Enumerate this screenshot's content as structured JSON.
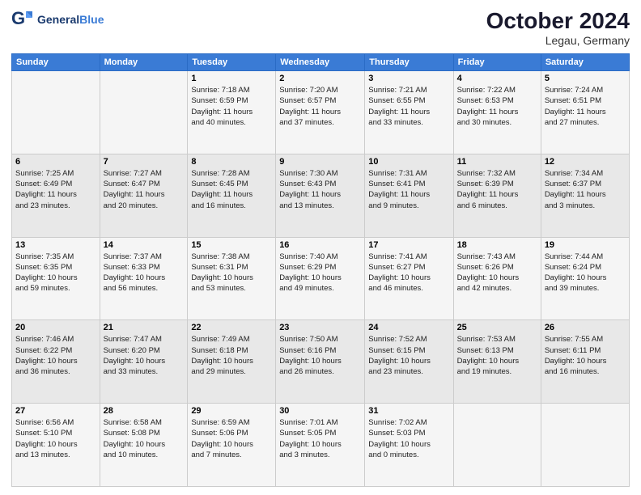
{
  "header": {
    "logo_line1": "General",
    "logo_line2": "Blue",
    "month_year": "October 2024",
    "location": "Legau, Germany"
  },
  "days_of_week": [
    "Sunday",
    "Monday",
    "Tuesday",
    "Wednesday",
    "Thursday",
    "Friday",
    "Saturday"
  ],
  "weeks": [
    [
      {
        "day": "",
        "info": ""
      },
      {
        "day": "",
        "info": ""
      },
      {
        "day": "1",
        "info": "Sunrise: 7:18 AM\nSunset: 6:59 PM\nDaylight: 11 hours\nand 40 minutes."
      },
      {
        "day": "2",
        "info": "Sunrise: 7:20 AM\nSunset: 6:57 PM\nDaylight: 11 hours\nand 37 minutes."
      },
      {
        "day": "3",
        "info": "Sunrise: 7:21 AM\nSunset: 6:55 PM\nDaylight: 11 hours\nand 33 minutes."
      },
      {
        "day": "4",
        "info": "Sunrise: 7:22 AM\nSunset: 6:53 PM\nDaylight: 11 hours\nand 30 minutes."
      },
      {
        "day": "5",
        "info": "Sunrise: 7:24 AM\nSunset: 6:51 PM\nDaylight: 11 hours\nand 27 minutes."
      }
    ],
    [
      {
        "day": "6",
        "info": "Sunrise: 7:25 AM\nSunset: 6:49 PM\nDaylight: 11 hours\nand 23 minutes."
      },
      {
        "day": "7",
        "info": "Sunrise: 7:27 AM\nSunset: 6:47 PM\nDaylight: 11 hours\nand 20 minutes."
      },
      {
        "day": "8",
        "info": "Sunrise: 7:28 AM\nSunset: 6:45 PM\nDaylight: 11 hours\nand 16 minutes."
      },
      {
        "day": "9",
        "info": "Sunrise: 7:30 AM\nSunset: 6:43 PM\nDaylight: 11 hours\nand 13 minutes."
      },
      {
        "day": "10",
        "info": "Sunrise: 7:31 AM\nSunset: 6:41 PM\nDaylight: 11 hours\nand 9 minutes."
      },
      {
        "day": "11",
        "info": "Sunrise: 7:32 AM\nSunset: 6:39 PM\nDaylight: 11 hours\nand 6 minutes."
      },
      {
        "day": "12",
        "info": "Sunrise: 7:34 AM\nSunset: 6:37 PM\nDaylight: 11 hours\nand 3 minutes."
      }
    ],
    [
      {
        "day": "13",
        "info": "Sunrise: 7:35 AM\nSunset: 6:35 PM\nDaylight: 10 hours\nand 59 minutes."
      },
      {
        "day": "14",
        "info": "Sunrise: 7:37 AM\nSunset: 6:33 PM\nDaylight: 10 hours\nand 56 minutes."
      },
      {
        "day": "15",
        "info": "Sunrise: 7:38 AM\nSunset: 6:31 PM\nDaylight: 10 hours\nand 53 minutes."
      },
      {
        "day": "16",
        "info": "Sunrise: 7:40 AM\nSunset: 6:29 PM\nDaylight: 10 hours\nand 49 minutes."
      },
      {
        "day": "17",
        "info": "Sunrise: 7:41 AM\nSunset: 6:27 PM\nDaylight: 10 hours\nand 46 minutes."
      },
      {
        "day": "18",
        "info": "Sunrise: 7:43 AM\nSunset: 6:26 PM\nDaylight: 10 hours\nand 42 minutes."
      },
      {
        "day": "19",
        "info": "Sunrise: 7:44 AM\nSunset: 6:24 PM\nDaylight: 10 hours\nand 39 minutes."
      }
    ],
    [
      {
        "day": "20",
        "info": "Sunrise: 7:46 AM\nSunset: 6:22 PM\nDaylight: 10 hours\nand 36 minutes."
      },
      {
        "day": "21",
        "info": "Sunrise: 7:47 AM\nSunset: 6:20 PM\nDaylight: 10 hours\nand 33 minutes."
      },
      {
        "day": "22",
        "info": "Sunrise: 7:49 AM\nSunset: 6:18 PM\nDaylight: 10 hours\nand 29 minutes."
      },
      {
        "day": "23",
        "info": "Sunrise: 7:50 AM\nSunset: 6:16 PM\nDaylight: 10 hours\nand 26 minutes."
      },
      {
        "day": "24",
        "info": "Sunrise: 7:52 AM\nSunset: 6:15 PM\nDaylight: 10 hours\nand 23 minutes."
      },
      {
        "day": "25",
        "info": "Sunrise: 7:53 AM\nSunset: 6:13 PM\nDaylight: 10 hours\nand 19 minutes."
      },
      {
        "day": "26",
        "info": "Sunrise: 7:55 AM\nSunset: 6:11 PM\nDaylight: 10 hours\nand 16 minutes."
      }
    ],
    [
      {
        "day": "27",
        "info": "Sunrise: 6:56 AM\nSunset: 5:10 PM\nDaylight: 10 hours\nand 13 minutes."
      },
      {
        "day": "28",
        "info": "Sunrise: 6:58 AM\nSunset: 5:08 PM\nDaylight: 10 hours\nand 10 minutes."
      },
      {
        "day": "29",
        "info": "Sunrise: 6:59 AM\nSunset: 5:06 PM\nDaylight: 10 hours\nand 7 minutes."
      },
      {
        "day": "30",
        "info": "Sunrise: 7:01 AM\nSunset: 5:05 PM\nDaylight: 10 hours\nand 3 minutes."
      },
      {
        "day": "31",
        "info": "Sunrise: 7:02 AM\nSunset: 5:03 PM\nDaylight: 10 hours\nand 0 minutes."
      },
      {
        "day": "",
        "info": ""
      },
      {
        "day": "",
        "info": ""
      }
    ]
  ]
}
